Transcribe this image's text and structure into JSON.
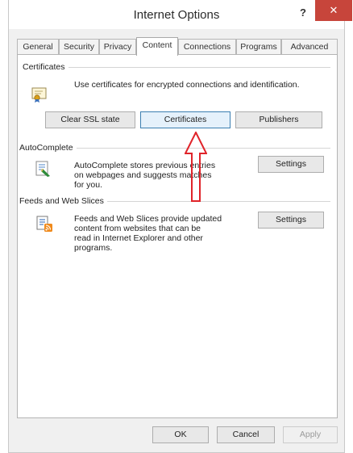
{
  "window": {
    "title": "Internet Options",
    "help": "?",
    "close": "✕"
  },
  "tabs": [
    "General",
    "Security",
    "Privacy",
    "Content",
    "Connections",
    "Programs",
    "Advanced"
  ],
  "active_tab": "Content",
  "certificates": {
    "title": "Certificates",
    "description": "Use certificates for encrypted connections and identification.",
    "buttons": {
      "clear_ssl": "Clear SSL state",
      "certificates": "Certificates",
      "publishers": "Publishers"
    }
  },
  "autocomplete": {
    "title": "AutoComplete",
    "description": [
      "AutoComplete stores previous entries",
      "on webpages and suggests matches",
      "for you."
    ],
    "settings": "Settings"
  },
  "feeds": {
    "title": "Feeds and Web Slices",
    "description": [
      "Feeds and Web Slices provide updated",
      "content from websites that can be",
      "read in Internet Explorer and other",
      "programs."
    ],
    "settings": "Settings"
  },
  "footer": {
    "ok": "OK",
    "cancel": "Cancel",
    "apply": "Apply"
  },
  "colors": {
    "close": "#c7453b",
    "arrow": "#e0242a",
    "focus": "#3c7fb1"
  }
}
